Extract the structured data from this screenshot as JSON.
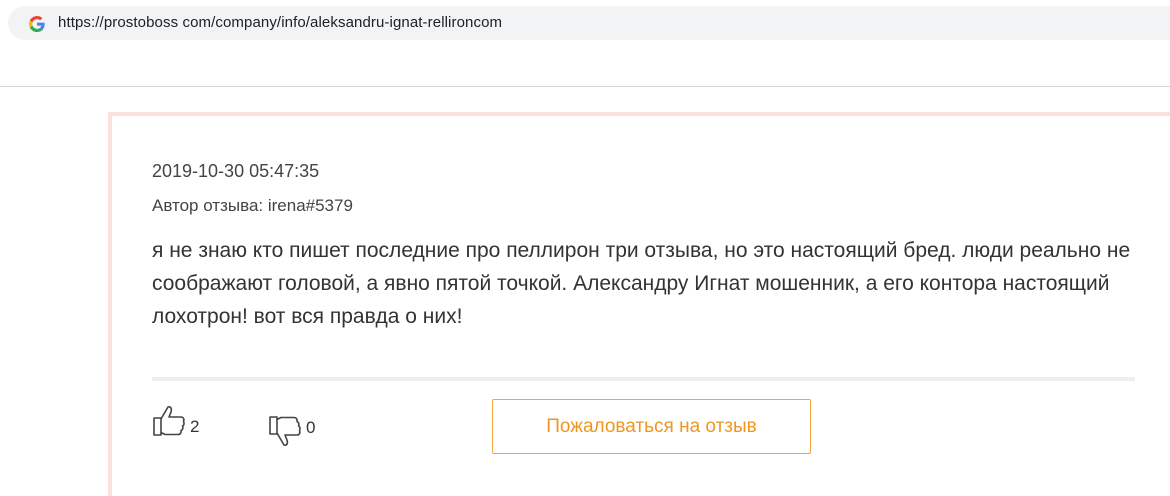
{
  "browser": {
    "url": "https://prostoboss com/company/info/aleksandru-ignat-rellironcom",
    "favicon_icon": "google-g-icon"
  },
  "review": {
    "date": "2019-10-30 05:47:35",
    "author": "Автор отзыва: irena#5379",
    "text": "я не знаю кто пишет последние про пеллирон три отзыва, но это настоящий бред. люди реально не соображают головой, а явно пятой точкой. Александру Игнат мошенник, а его контора настоящий лохотрон! вот вся правда о них!",
    "likes": "2",
    "dislikes": "0",
    "like_icon": "thumbs-up-icon",
    "dislike_icon": "thumbs-down-icon",
    "complain_label": "Пожаловаться на отзыв"
  },
  "colors": {
    "accent": "#f0961f",
    "card_border": "#fbe1dd"
  }
}
